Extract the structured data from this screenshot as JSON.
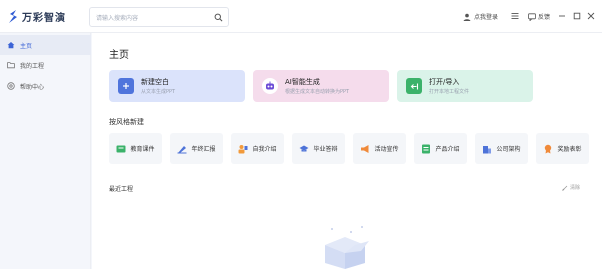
{
  "app": {
    "title": "万彩智演"
  },
  "topbar": {
    "search_placeholder": "请输入搜索内容",
    "login_label": "点我登录",
    "feedback_label": "反馈"
  },
  "sidebar": {
    "items": [
      {
        "label": "主页",
        "icon": "home-icon"
      },
      {
        "label": "我的工程",
        "icon": "folder-icon"
      },
      {
        "label": "帮助中心",
        "icon": "help-icon"
      }
    ]
  },
  "main": {
    "title": "主页",
    "cards": [
      {
        "title": "新建空白",
        "subtitle": "从文本生成PPT",
        "color": "#dbe3fb",
        "icon": "plus-icon"
      },
      {
        "title": "AI智能生成",
        "subtitle": "根据生成文本自动转换为PPT",
        "color": "#f5dcec",
        "icon": "robot-icon"
      },
      {
        "title": "打开/导入",
        "subtitle": "打开本地工程文件",
        "color": "#daf3e9",
        "icon": "import-icon"
      }
    ],
    "style_section_title": "按风格新建",
    "styles": [
      {
        "label": "教育课件",
        "icon": "education-icon",
        "color": "#3bb26a"
      },
      {
        "label": "年终汇报",
        "icon": "report-icon",
        "color": "#4e73d8"
      },
      {
        "label": "自我介绍",
        "icon": "intro-icon",
        "color": "#f29a3b"
      },
      {
        "label": "毕业答辩",
        "icon": "graduation-icon",
        "color": "#4e73d8"
      },
      {
        "label": "活动宣传",
        "icon": "megaphone-icon",
        "color": "#f08a3a"
      },
      {
        "label": "产品介绍",
        "icon": "product-icon",
        "color": "#3bb26a"
      },
      {
        "label": "公司架构",
        "icon": "building-icon",
        "color": "#4e73d8"
      },
      {
        "label": "奖励表彰",
        "icon": "award-icon",
        "color": "#f08a3a"
      }
    ],
    "recent_title": "最近工程",
    "clear_label": "清除"
  }
}
